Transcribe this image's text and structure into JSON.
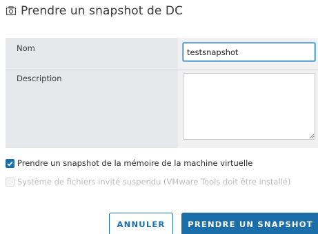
{
  "dialog": {
    "title": "Prendre un snapshot de DC",
    "title_icon": "camera-icon"
  },
  "form": {
    "name_label": "Nom",
    "name_value": "testsnapshot",
    "description_label": "Description",
    "description_value": ""
  },
  "options": {
    "snapshot_memory": {
      "label": "Prendre un snapshot de la mémoire de la machine virtuelle",
      "checked": true
    },
    "quiesce": {
      "label": "Système de fichiers invité suspendu (VMware Tools doit être installé)",
      "checked": false,
      "disabled": true
    }
  },
  "buttons": {
    "cancel_label": "ANNULER",
    "submit_label": "PRENDRE UN SNAPSHOT"
  },
  "colors": {
    "accent": "#1a6ea9",
    "label_column_bg": "#e6e8ec",
    "disabled_text": "#bdbdbd"
  }
}
